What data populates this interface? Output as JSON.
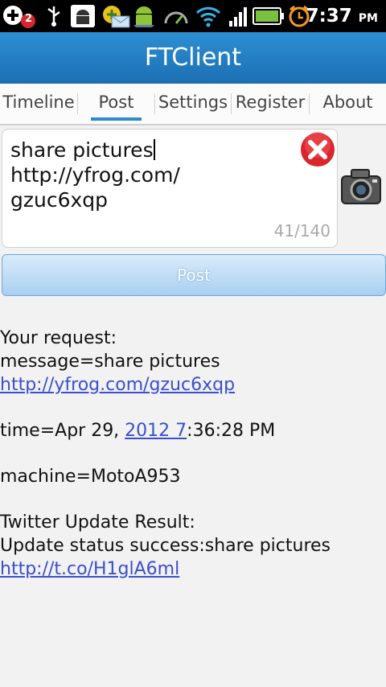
{
  "status_bar": {
    "notification_count": "2",
    "time": "7:37",
    "ampm": "PM"
  },
  "app": {
    "title": "FTClient"
  },
  "tabs": [
    {
      "label": "Timeline"
    },
    {
      "label": "Post"
    },
    {
      "label": "Settings"
    },
    {
      "label": "Register"
    },
    {
      "label": "About"
    }
  ],
  "compose": {
    "text_before_cursor": "share pictures",
    "text_after_cursor": "http://yfrog.com/\ngzuc6xqp",
    "counter": "41/140"
  },
  "post_button": {
    "label": "Post"
  },
  "result": {
    "request_heading": "Your request:",
    "message_prefix": "message=share pictures ",
    "message_link": "http://yfrog.com/gzuc6xqp",
    "time_prefix": "time=Apr 29, ",
    "time_link": "2012 7",
    "time_suffix": ":36:28 PM",
    "machine": "machine=MotoA953",
    "twitter_heading": "Twitter Update Result:",
    "update_prefix": "Update status success:share pictures ",
    "update_link": "http://t.co/H1glA6ml"
  },
  "colors": {
    "title_bar": "#1c6fb3",
    "tab_indicator": "#2a8ad4",
    "link": "#3a4fcf",
    "clear_button": "#d9262c"
  }
}
